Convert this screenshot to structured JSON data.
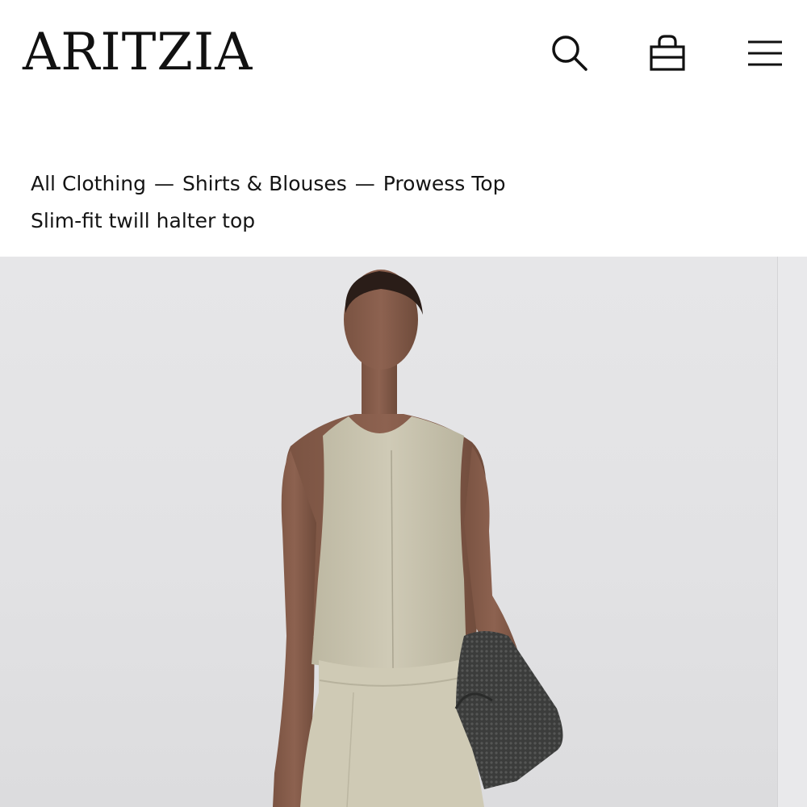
{
  "brand": {
    "logo_text": "ARITZIA"
  },
  "header": {
    "icons": [
      "search-icon",
      "shopping-bag-icon",
      "hamburger-menu-icon"
    ]
  },
  "breadcrumb": {
    "items": [
      "All Clothing",
      "Shirts & Blouses",
      "Prowess Top"
    ],
    "separator": "—"
  },
  "product": {
    "subtitle": "Slim-fit twill halter top",
    "image": {
      "description_icon": "product-photo",
      "top_color": "#cbc6b1",
      "skirt_color": "#d0cbb6",
      "bag_color": "#3a3b3a",
      "background_color": "#e4e4e6"
    }
  }
}
